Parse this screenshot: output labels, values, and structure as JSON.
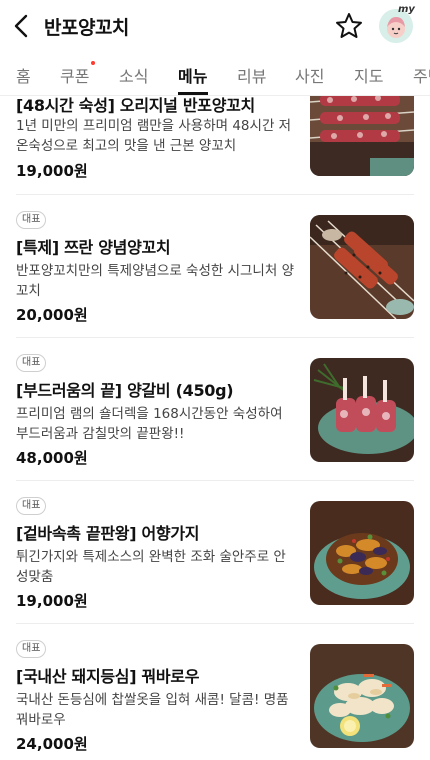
{
  "header": {
    "title": "반포양꼬치",
    "avatar_text": "my"
  },
  "tabs": [
    {
      "label": "홈",
      "active": false
    },
    {
      "label": "쿠폰",
      "active": false,
      "dot": true
    },
    {
      "label": "소식",
      "active": false
    },
    {
      "label": "메뉴",
      "active": true
    },
    {
      "label": "리뷰",
      "active": false
    },
    {
      "label": "사진",
      "active": false
    },
    {
      "label": "지도",
      "active": false
    },
    {
      "label": "주변",
      "active": false
    }
  ],
  "menu_items": [
    {
      "badge": "",
      "name": "[48시간 숙성] 오리지널 반포양꼬치",
      "desc": "1년 미만의 프리미엄 램만을 사용하며 48시간 저온숙성으로 최고의 맛을 낸 근본 양꼬치",
      "price": "19,000원"
    },
    {
      "badge": "대표",
      "name": "[특제] 쯔란 양념양꼬치",
      "desc": "반포양꼬치만의 특제양념으로 숙성한 시그니처 양꼬치",
      "price": "20,000원"
    },
    {
      "badge": "대표",
      "name": "[부드러움의 끝] 양갈비 (450g)",
      "desc": "프리미엄 램의 숄더렉을 168시간동안 숙성하여 부드러움과 감칠맛의 끝판왕!!",
      "price": "48,000원"
    },
    {
      "badge": "대표",
      "name": "[겉바속촉 끝판왕] 어향가지",
      "desc": "튀긴가지와 특제소스의 완벽한 조화 술안주로 안성맞춤",
      "price": "19,000원"
    },
    {
      "badge": "대표",
      "name": "[국내산 돼지등심] 꿔바로우",
      "desc": "국내산 돈등심에 찹쌀옷을 입혀 새콤! 달콤! 명품 꿔바로우",
      "price": "24,000원"
    }
  ]
}
